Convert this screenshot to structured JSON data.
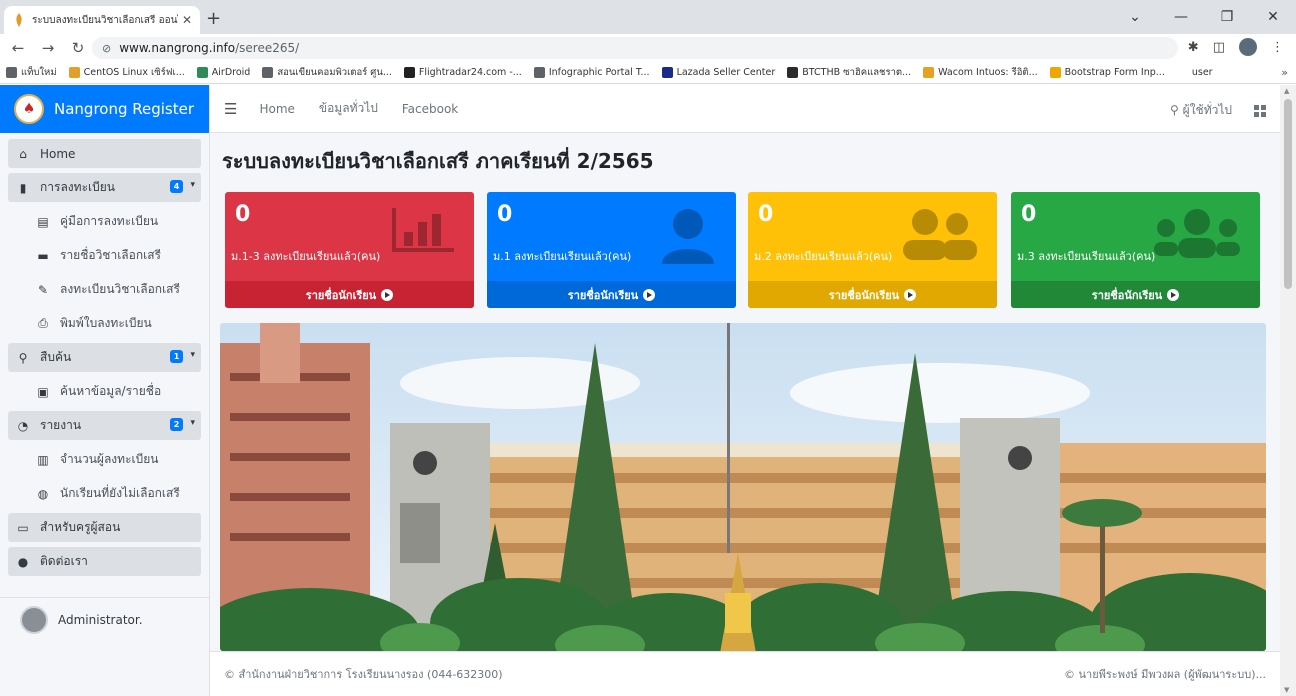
{
  "browser": {
    "tab_title": "ระบบลงทะเบียนวิชาเลือกเสรี ออนไลน์",
    "url_host": "www.nangrong.info",
    "url_path": "/seree265/",
    "bookmarks": [
      {
        "label": "แท็บใหม่",
        "color": "#5f6368"
      },
      {
        "label": "CentOS Linux เซิร์ฟเ...",
        "color": "#e0a02a"
      },
      {
        "label": "AirDroid",
        "color": "#2e8b57"
      },
      {
        "label": "สอนเขียนคอมพิวเตอร์ ศูน...",
        "color": "#5f6368"
      },
      {
        "label": "Flightradar24.com -...",
        "color": "#222222"
      },
      {
        "label": "Infographic Portal T...",
        "color": "#5f6368"
      },
      {
        "label": "Lazada Seller Center",
        "color": "#1a2a8a"
      },
      {
        "label": "BTCTHB ซาฮิคแลชราต...",
        "color": "#2b2b2b"
      },
      {
        "label": "Wacom Intuos: รีอิติ...",
        "color": "#e8a020"
      },
      {
        "label": "Bootstrap Form Inp...",
        "color": "#f0a500"
      },
      {
        "label": "user",
        "color": "#ffffff"
      }
    ]
  },
  "brand": {
    "name": "Nangrong Register"
  },
  "sidebar": {
    "items": [
      {
        "label": "Home",
        "type": "top",
        "icon": "home-icon"
      },
      {
        "label": "การลงทะเบียน",
        "type": "top",
        "icon": "file-icon",
        "badge": "4"
      },
      {
        "label": "คู่มือการลงทะเบียน",
        "type": "sub",
        "icon": "book-icon"
      },
      {
        "label": "รายชื่อวิชาเลือกเสรี",
        "type": "sub",
        "icon": "list-icon"
      },
      {
        "label": "ลงทะเบียนวิชาเลือกเสรี",
        "type": "sub",
        "icon": "edit-icon"
      },
      {
        "label": "พิมพ์ใบลงทะเบียน",
        "type": "sub",
        "icon": "print-icon"
      },
      {
        "label": "สืบค้น",
        "type": "top",
        "icon": "search-icon",
        "badge": "1"
      },
      {
        "label": "ค้นหาข้อมูล/รายชื่อ",
        "type": "sub",
        "icon": "search-doc-icon"
      },
      {
        "label": "รายงาน",
        "type": "top",
        "icon": "pie-chart-icon",
        "badge": "2"
      },
      {
        "label": "จำนวนผู้ลงทะเบียน",
        "type": "sub",
        "icon": "bar-chart-icon"
      },
      {
        "label": "นักเรียนที่ยังไม่เลือกเสรี",
        "type": "sub",
        "icon": "user-slash-icon"
      },
      {
        "label": "สำหรับครูผู้สอน",
        "type": "top",
        "icon": "teacher-icon"
      },
      {
        "label": "ติดต่อเรา",
        "type": "top",
        "icon": "contact-icon"
      }
    ],
    "user": "Administrator."
  },
  "topnav": {
    "links": [
      "Home",
      "ข้อมูลทั่วไป",
      "Facebook"
    ],
    "user_label": "ผู้ใช้ทั่วไป"
  },
  "page": {
    "title": "ระบบลงทะเบียนวิชาเลือกเสรี ภาคเรียนที่ 2/2565"
  },
  "boxes": [
    {
      "count": "0",
      "label": "ม.1-3 ลงทะเบียนเรียนแล้ว(คน)",
      "link": "รายชื่อนักเรียน",
      "icon": "bar-chart-icon",
      "color": "#dc3545"
    },
    {
      "count": "0",
      "label": "ม.1 ลงทะเบียนเรียนแล้ว(คน)",
      "link": "รายชื่อนักเรียน",
      "icon": "user-icon",
      "color": "#007bff"
    },
    {
      "count": "0",
      "label": "ม.2 ลงทะเบียนเรียนแล้ว(คน)",
      "link": "รายชื่อนักเรียน",
      "icon": "user-friends-icon",
      "color": "#ffc107"
    },
    {
      "count": "0",
      "label": "ม.3 ลงทะเบียนเรียนแล้ว(คน)",
      "link": "รายชื่อนักเรียน",
      "icon": "users-icon",
      "color": "#28a745"
    }
  ],
  "footer": {
    "left": "© สำนักงานฝ่ายวิชาการ โรงเรียนนางรอง (044-632300)",
    "right": "© นายพีระพงษ์ มีพวงผล (ผู้พัฒนาระบบ)..."
  }
}
